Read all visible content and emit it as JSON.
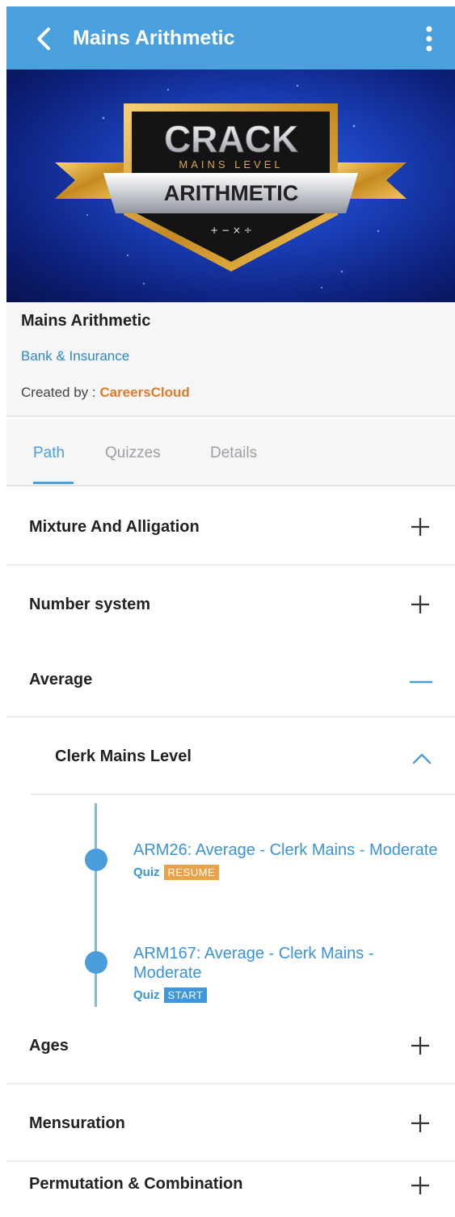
{
  "appbar": {
    "title": "Mains Arithmetic",
    "back_icon": "chevron-left-icon",
    "menu_icon": "more-vertical-icon",
    "color": "#4aa0dd"
  },
  "banner": {
    "line1": "CRACK",
    "line2": "MAINS LEVEL",
    "line3": "ARITHMETIC",
    "symbols": "+ − × ÷"
  },
  "course": {
    "title": "Mains Arithmetic",
    "category": "Bank & Insurance",
    "created_by_label": "Created by : ",
    "author": "CareersCloud"
  },
  "tabs": [
    {
      "label": "Path",
      "active": true
    },
    {
      "label": "Quizzes",
      "active": false
    },
    {
      "label": "Details",
      "active": false
    }
  ],
  "topics": [
    {
      "label": "Mixture And Alligation",
      "state": "collapsed"
    },
    {
      "label": "Number system",
      "state": "collapsed"
    },
    {
      "label": "Average",
      "state": "expanded"
    },
    {
      "label": "Ages",
      "state": "collapsed"
    },
    {
      "label": "Mensuration",
      "state": "collapsed"
    },
    {
      "label": "Permutation & Combination",
      "state": "collapsed"
    }
  ],
  "subsection": {
    "label": "Clerk Mains Level",
    "state": "expanded"
  },
  "quizzes": [
    {
      "title": "ARM26: Average - Clerk Mains - Moderate",
      "type": "Quiz",
      "status": "RESUME",
      "status_color": "#e8a24a"
    },
    {
      "title": "ARM167: Average - Clerk Mains - Moderate",
      "type": "Quiz",
      "status": "START",
      "status_color": "#3d97df"
    }
  ]
}
